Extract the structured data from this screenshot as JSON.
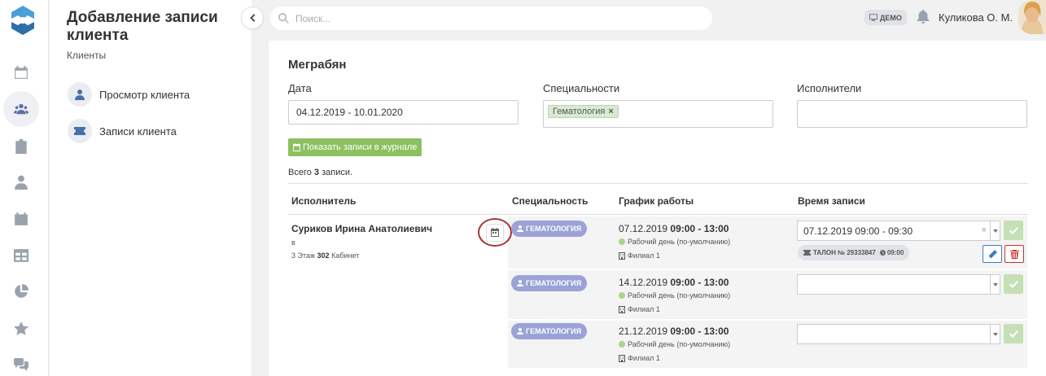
{
  "page": {
    "title": "Добавление записи клиента",
    "subtitle": "Клиенты"
  },
  "sidebar_nav": [
    {
      "label": "Просмотр клиента",
      "icon": "user-icon"
    },
    {
      "label": "Записи клиента",
      "icon": "ticket-icon"
    }
  ],
  "rail": [
    "calendar-icon",
    "users-icon",
    "clipboard-icon",
    "doctor-icon",
    "calendar-day-icon",
    "table-icon",
    "pie-chart-icon",
    "star-icon",
    "chat-icon"
  ],
  "header": {
    "search_placeholder": "Поиск...",
    "demo_badge": "ДЕМО",
    "user_name": "Куликова О. М."
  },
  "client": {
    "name": "Меграбян"
  },
  "filters": {
    "date_label": "Дата",
    "date_value": "04.12.2019 - 10.01.2020",
    "specialties_label": "Специальности",
    "specialty_tag": "Гематология",
    "specialty_tag_remove": "×",
    "executors_label": "Исполнители",
    "executors_value": "",
    "show_button": "Показать записи в журнале"
  },
  "summary": {
    "prefix": "Всего ",
    "count": "3",
    "suffix": " записи."
  },
  "table": {
    "columns": [
      "Исполнитель",
      "Специальность",
      "График работы",
      "Время записи"
    ],
    "executor": {
      "name": "Суриков Ирина Анатолиевич",
      "line2": "в",
      "floor": "3 Этаж",
      "room_number": "302",
      "room_label": "Кабинет"
    },
    "rows": [
      {
        "specialty": "ГЕМАТОЛОГИЯ",
        "date": "07.12.2019",
        "hours": "09:00 - 13:00",
        "day_type": "Рабочий день (по-умолчанию)",
        "branch": "Филиал 1",
        "slot_value": "07.12.2019 09:00 - 09:30",
        "slot_clear": "×",
        "ticket": "ТАЛОН № 29333847",
        "ticket_time": "09:00"
      },
      {
        "specialty": "ГЕМАТОЛОГИЯ",
        "date": "14.12.2019",
        "hours": "09:00 - 13:00",
        "day_type": "Рабочий день (по-умолчанию)",
        "branch": "Филиал 1",
        "slot_value": ""
      },
      {
        "specialty": "ГЕМАТОЛОГИЯ",
        "date": "21.12.2019",
        "hours": "09:00 - 13:00",
        "day_type": "Рабочий день (по-умолчанию)",
        "branch": "Филиал 1",
        "slot_value": ""
      }
    ]
  },
  "colors": {
    "accent_green": "#8cc060",
    "badge_purple": "#9ba3d6",
    "highlight_circle": "#a83434",
    "edit_blue": "#3a7fc1",
    "delete_red": "#c9302c"
  }
}
